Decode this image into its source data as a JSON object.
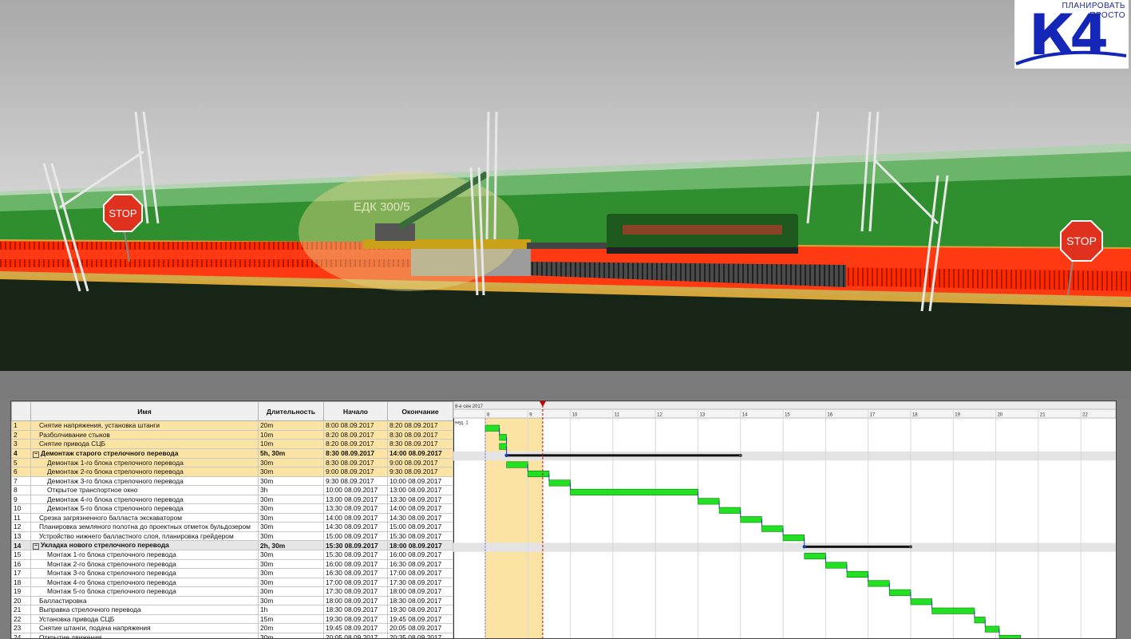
{
  "scene": {
    "label_crane": "ЕДК 300/5",
    "stop_sign": "STOP"
  },
  "logo": {
    "line1": "ПЛАНИРОВАТЬ",
    "line2": "ПРОСТО",
    "mark": "К4"
  },
  "columns": {
    "name": "Имя",
    "duration": "Длительность",
    "start": "Начало",
    "end": "Окончание"
  },
  "timescale": {
    "top": "8-е сен 2017",
    "week": "нед. 1",
    "hours": [
      "8",
      "9",
      "10",
      "11",
      "12",
      "13",
      "14",
      "15",
      "16",
      "17",
      "18",
      "19",
      "20",
      "21",
      "22",
      "23"
    ]
  },
  "tasks": [
    {
      "id": "1",
      "name": "Снятие напряжения, установка штанги",
      "duration": "20m",
      "start": "8:00 08.09.2017",
      "end": "8:20 08.09.2017",
      "indent": 1,
      "summary": false,
      "hl": true
    },
    {
      "id": "2",
      "name": "Разболчивание стыков",
      "duration": "10m",
      "start": "8:20 08.09.2017",
      "end": "8:30 08.09.2017",
      "indent": 1,
      "summary": false,
      "hl": true
    },
    {
      "id": "3",
      "name": "Снятие привода СЦБ",
      "duration": "10m",
      "start": "8:20 08.09.2017",
      "end": "8:30 08.09.2017",
      "indent": 1,
      "summary": false,
      "hl": true
    },
    {
      "id": "4",
      "name": "Демонтаж старого стрелочного перевода",
      "duration": "5h, 30m",
      "start": "8:30 08.09.2017",
      "end": "14:00 08.09.2017",
      "indent": 0,
      "summary": true,
      "hl": true
    },
    {
      "id": "5",
      "name": "Демонтаж 1-го блока стрелочного перевода",
      "duration": "30m",
      "start": "8:30 08.09.2017",
      "end": "9:00 08.09.2017",
      "indent": 2,
      "summary": false,
      "hl": true
    },
    {
      "id": "6",
      "name": "Демонтаж 2-го блока стрелочного перевода",
      "duration": "30m",
      "start": "9:00 08.09.2017",
      "end": "9:30 08.09.2017",
      "indent": 2,
      "summary": false,
      "hl": true
    },
    {
      "id": "7",
      "name": "Демонтаж 3-го блока стрелочного перевода",
      "duration": "30m",
      "start": "9:30 08.09.2017",
      "end": "10:00 08.09.2017",
      "indent": 2,
      "summary": false,
      "hl": false
    },
    {
      "id": "8",
      "name": "Открытое транспортное окно",
      "duration": "3h",
      "start": "10:00 08.09.2017",
      "end": "13:00 08.09.2017",
      "indent": 2,
      "summary": false,
      "hl": false
    },
    {
      "id": "9",
      "name": "Демонтаж 4-го блока стрелочного перевода",
      "duration": "30m",
      "start": "13:00 08.09.2017",
      "end": "13:30 08.09.2017",
      "indent": 2,
      "summary": false,
      "hl": false
    },
    {
      "id": "10",
      "name": "Демонтаж 5-го блока стрелочного перевода",
      "duration": "30m",
      "start": "13:30 08.09.2017",
      "end": "14:00 08.09.2017",
      "indent": 2,
      "summary": false,
      "hl": false
    },
    {
      "id": "11",
      "name": "Срезка загрязненного балласта экскаватором",
      "duration": "30m",
      "start": "14:00 08.09.2017",
      "end": "14:30 08.09.2017",
      "indent": 1,
      "summary": false,
      "hl": false
    },
    {
      "id": "12",
      "name": "Планировка земляного полотна до проектных отметок бульдозером",
      "duration": "30m",
      "start": "14:30 08.09.2017",
      "end": "15:00 08.09.2017",
      "indent": 1,
      "summary": false,
      "hl": false
    },
    {
      "id": "13",
      "name": "Устройство нижнего балластного слоя, планировка грейдером",
      "duration": "30m",
      "start": "15:00 08.09.2017",
      "end": "15:30 08.09.2017",
      "indent": 1,
      "summary": false,
      "hl": false
    },
    {
      "id": "14",
      "name": "Укладка нового стрелочного перевода",
      "duration": "2h, 30m",
      "start": "15:30 08.09.2017",
      "end": "18:00 08.09.2017",
      "indent": 0,
      "summary": true,
      "hl": false
    },
    {
      "id": "15",
      "name": "Монтаж 1-го блока стрелочного перевода",
      "duration": "30m",
      "start": "15:30 08.09.2017",
      "end": "16:00 08.09.2017",
      "indent": 2,
      "summary": false,
      "hl": false
    },
    {
      "id": "16",
      "name": "Монтаж 2-го блока стрелочного перевода",
      "duration": "30m",
      "start": "16:00 08.09.2017",
      "end": "16:30 08.09.2017",
      "indent": 2,
      "summary": false,
      "hl": false
    },
    {
      "id": "17",
      "name": "Монтаж 3-го блока стрелочного перевода",
      "duration": "30m",
      "start": "16:30 08.09.2017",
      "end": "17:00 08.09.2017",
      "indent": 2,
      "summary": false,
      "hl": false
    },
    {
      "id": "18",
      "name": "Монтаж 4-го блока стрелочного перевода",
      "duration": "30m",
      "start": "17:00 08.09.2017",
      "end": "17:30 08.09.2017",
      "indent": 2,
      "summary": false,
      "hl": false
    },
    {
      "id": "19",
      "name": "Монтаж 5-го блока стрелочного перевода",
      "duration": "30m",
      "start": "17:30 08.09.2017",
      "end": "18:00 08.09.2017",
      "indent": 2,
      "summary": false,
      "hl": false
    },
    {
      "id": "20",
      "name": "Балластировка",
      "duration": "30m",
      "start": "18:00 08.09.2017",
      "end": "18:30 08.09.2017",
      "indent": 1,
      "summary": false,
      "hl": false
    },
    {
      "id": "21",
      "name": "Выправка стрелочного перевода",
      "duration": "1h",
      "start": "18:30 08.09.2017",
      "end": "19:30 08.09.2017",
      "indent": 1,
      "summary": false,
      "hl": false
    },
    {
      "id": "22",
      "name": "Установка привода СЦБ",
      "duration": "15m",
      "start": "19:30 08.09.2017",
      "end": "19:45 08.09.2017",
      "indent": 1,
      "summary": false,
      "hl": false
    },
    {
      "id": "23",
      "name": "Снятие штанги, подача напряжения",
      "duration": "20m",
      "start": "19:45 08.09.2017",
      "end": "20:05 08.09.2017",
      "indent": 1,
      "summary": false,
      "hl": false
    },
    {
      "id": "24",
      "name": "Открытие движения",
      "duration": "30m",
      "start": "20:05 08.09.2017",
      "end": "20:35 08.09.2017",
      "indent": 1,
      "summary": false,
      "hl": false
    }
  ],
  "gantt": {
    "start_hour": 7.25,
    "current_time_hour": 9.35,
    "highlight_from_hour": 8,
    "highlight_to_hour": 9.35,
    "colors": {
      "task_bar": "#22e022",
      "summary_bar": "#111111",
      "highlight": "#fbe3a3",
      "current_line": "#cc0000"
    }
  }
}
